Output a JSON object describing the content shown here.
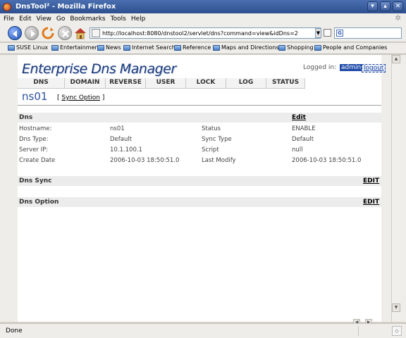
{
  "window": {
    "title": "DnsTool² - Mozilla Firefox"
  },
  "menu": [
    "File",
    "Edit",
    "View",
    "Go",
    "Bookmarks",
    "Tools",
    "Help"
  ],
  "toolbar": {
    "url": "http://localhost:8080/dnstool2/servlet/dns?command=view&idDns=2",
    "search_placeholder": ""
  },
  "bookmarks": [
    "SUSE Linux",
    "Entertainment",
    "News",
    "Internet Search",
    "Reference",
    "Maps and Directions",
    "Shopping",
    "People and Companies"
  ],
  "page": {
    "logo": "Enterprise Dns Manager",
    "login_label": "Logged in:",
    "user": "admin",
    "logout": "logout",
    "tabs": [
      "DNS",
      "DOMAIN",
      "REVERSE",
      "USER",
      "LOCK",
      "LOG",
      "STATUS"
    ],
    "hostname": "ns01",
    "sync_option": "Sync Option",
    "sections": {
      "dns": {
        "title": "Dns",
        "action": "Edit"
      },
      "sync": {
        "title": "Dns Sync",
        "action": "EDIT"
      },
      "option": {
        "title": "Dns Option",
        "action": "EDIT"
      }
    },
    "dns_fields": [
      {
        "label": "Hostname:",
        "value": "ns01",
        "label2": "Status",
        "value2": "ENABLE"
      },
      {
        "label": "Dns Type:",
        "value": "Default",
        "label2": "Sync Type",
        "value2": "Default"
      },
      {
        "label": "Server IP:",
        "value": "10.1.100.1",
        "label2": "Script",
        "value2": "null"
      },
      {
        "label": "Create Date",
        "value": "2006-10-03 18:50:51.0",
        "label2": "Last Modify",
        "value2": "2006-10-03 18:50:51.0"
      }
    ]
  },
  "statusbar": {
    "text": "Done"
  }
}
